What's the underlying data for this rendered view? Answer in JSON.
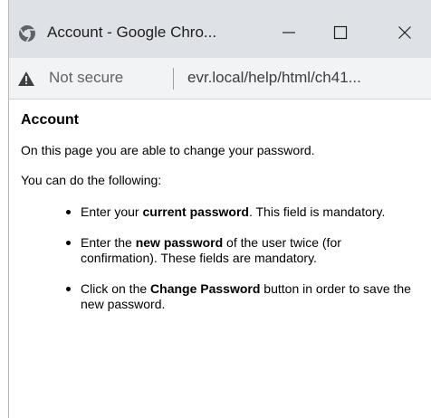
{
  "window": {
    "title": "Account - Google Chro...",
    "controls": {
      "minimize": "minimize",
      "maximize": "maximize",
      "close": "close"
    }
  },
  "address_bar": {
    "security_label": "Not secure",
    "url": "evr.local/help/html/ch41..."
  },
  "page": {
    "heading": "Account",
    "intro": "On this page you are able to change your password.",
    "lead": "You can do the following:",
    "items": [
      {
        "pre": "Enter your ",
        "bold": "current password",
        "post": ". This field is mandatory."
      },
      {
        "pre": "Enter the ",
        "bold": "new password",
        "post": " of the user twice (for confirmation). These fields are mandatory."
      },
      {
        "pre": "Click on the ",
        "bold": "Change Password",
        "post": " button in order to save the new password."
      }
    ]
  },
  "colors": {
    "titlebar_bg": "#dee1e6",
    "addressbar_bg": "#f1f3f4",
    "text": "#000000"
  }
}
